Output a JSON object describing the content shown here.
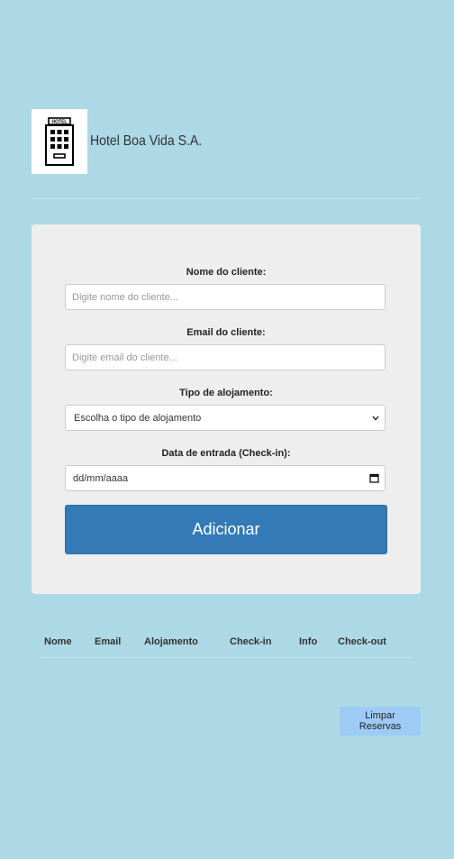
{
  "header": {
    "logo_icon": "hotel-building-icon",
    "logo_text": "HOTEL",
    "hotel_name": "Hotel Boa Vida S.A."
  },
  "form": {
    "name_label": "Nome do cliente:",
    "name_placeholder": "Digite nome do cliente...",
    "email_label": "Email do cliente:",
    "email_placeholder": "Digite email do cliente...",
    "type_label": "Tipo de alojamento:",
    "type_selected": "Escolha o tipo de alojamento",
    "date_label": "Data de entrada (Check-in):",
    "date_placeholder": "dd/mm/aaaa",
    "add_button": "Adicionar"
  },
  "table": {
    "columns": [
      "Nome",
      "Email",
      "Alojamento",
      "Check-in",
      "Info",
      "Check-out"
    ]
  },
  "actions": {
    "clear_button": "Limpar Reservas"
  },
  "colors": {
    "background": "#add8e6",
    "card": "#eeeeee",
    "primary_button": "#337ab7",
    "clear_button": "#9ecbf5"
  }
}
